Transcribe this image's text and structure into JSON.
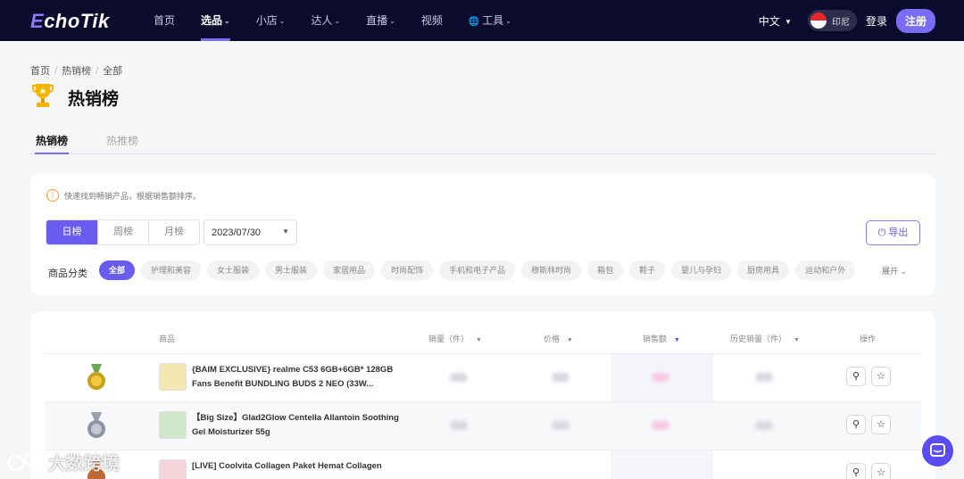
{
  "brand": {
    "logo_e": "E",
    "logo_rest": "choTik"
  },
  "nav": {
    "items": [
      {
        "label": "首页"
      },
      {
        "label": "选品",
        "caret": true,
        "active": true
      },
      {
        "label": "小店",
        "caret": true
      },
      {
        "label": "达人",
        "caret": true
      },
      {
        "label": "直播",
        "caret": true
      },
      {
        "label": "视频"
      },
      {
        "label": "工具",
        "caret": true,
        "globe": true
      }
    ],
    "language": "中文",
    "country": "印尼",
    "login": "登录",
    "register": "注册"
  },
  "breadcrumb": [
    "首页",
    "热销榜",
    "全部"
  ],
  "page_title": "热销榜",
  "tabs": [
    "热销榜",
    "热推榜"
  ],
  "filters": {
    "tip": "快速找到畅销产品，根据销售额排序。",
    "periods": [
      "日榜",
      "周榜",
      "月榜"
    ],
    "active_period": "日榜",
    "date": "2023/07/30",
    "export_label": "导出",
    "category_label": "商品分类",
    "categories": [
      "全部",
      "护理和美容",
      "女士服装",
      "男士服装",
      "家居用品",
      "时尚配饰",
      "手机和电子产品",
      "穆斯林时尚",
      "箱包",
      "鞋子",
      "婴儿与孕妇",
      "厨房用具",
      "运动和户外"
    ],
    "active_category": "全部",
    "expand_label": "展开"
  },
  "table": {
    "columns": [
      "商品",
      "销量（件）",
      "价格",
      "销售额",
      "历史销量（件）",
      "操作"
    ],
    "sorted_column": "销售额",
    "rows": [
      {
        "name": "{BAIM EXCLUSIVE} realme C53 6GB+6GB* 128GB Fans Benefit BUNDLING BUDS 2 NEO (33W...",
        "medal": "gold"
      },
      {
        "name": "【Big Size】Glad2Glow Centella Allantoin Soothing Gel Moisturizer 55g",
        "medal": "silver"
      },
      {
        "name": "[LIVE] Coolvita Collagen Paket Hemat Collagen",
        "medal": "bronze"
      }
    ]
  },
  "colors": {
    "accent": "#6b5cf0",
    "nav_bg": "#0b0b2e"
  },
  "watermark": "大数跨境"
}
